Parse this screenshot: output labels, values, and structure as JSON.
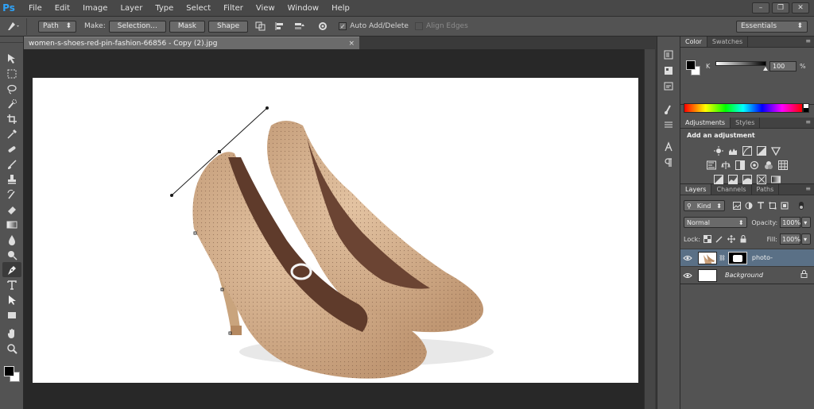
{
  "app": {
    "logo": "Ps"
  },
  "menu": [
    "File",
    "Edit",
    "Image",
    "Layer",
    "Type",
    "Select",
    "Filter",
    "View",
    "Window",
    "Help"
  ],
  "window_controls": {
    "minimize": "–",
    "restore": "❐",
    "close": "✕"
  },
  "options_bar": {
    "mode": "Path",
    "make_label": "Make:",
    "selection_button": "Selection...",
    "mask_button": "Mask",
    "shape_button": "Shape",
    "auto_add_delete": "Auto Add/Delete",
    "align_edges": "Align Edges",
    "workspace": "Essentials"
  },
  "document": {
    "tab_title": "women-s-shoes-red-pin-fashion-66856 - Copy (2).jpg",
    "tab_close": "×"
  },
  "color_panel": {
    "tabs": [
      "Color",
      "Swatches"
    ],
    "channel": "K",
    "value": "100",
    "unit": "%",
    "slider_fraction": 1.0
  },
  "adjustments_panel": {
    "tabs": [
      "Adjustments",
      "Styles"
    ],
    "title": "Add an adjustment"
  },
  "layers_panel": {
    "tabs": [
      "Layers",
      "Channels",
      "Paths"
    ],
    "filter_kind": "Kind",
    "blend_mode": "Normal",
    "opacity_label": "Opacity:",
    "opacity_value": "100%",
    "lock_label": "Lock:",
    "fill_label": "Fill:",
    "fill_value": "100%",
    "layers": [
      {
        "name": "photo-",
        "selected": true
      },
      {
        "name": "Background",
        "selected": false
      }
    ]
  },
  "colors": {
    "app_blue": "#2fa3f8",
    "panel_bg": "#535353",
    "pasteboard": "#282828",
    "selected_layer": "#5a7086"
  },
  "icons": {
    "tools": [
      "move-icon",
      "marquee-icon",
      "lasso-icon",
      "quick-select-icon",
      "crop-icon",
      "eyedropper-icon",
      "healing-brush-icon",
      "brush-icon",
      "clone-stamp-icon",
      "history-brush-icon",
      "eraser-icon",
      "gradient-icon",
      "blur-icon",
      "dodge-icon",
      "pen-icon",
      "type-icon",
      "path-select-icon",
      "rectangle-icon",
      "hand-icon",
      "zoom-icon"
    ]
  }
}
